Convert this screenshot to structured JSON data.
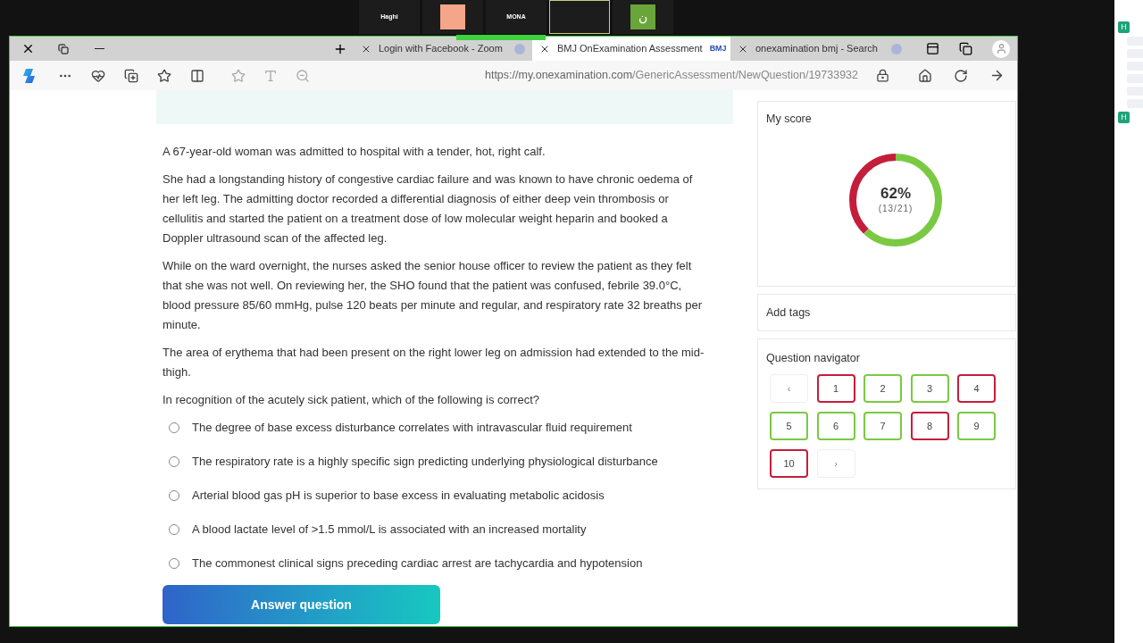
{
  "meeting": {
    "participants": [
      {
        "name": "Haghi",
        "kind": "name"
      },
      {
        "kind": "color",
        "color": "#f4a58a"
      },
      {
        "name": "MONA",
        "kind": "name"
      },
      {
        "kind": "blank",
        "selected": true
      },
      {
        "name": "ن",
        "kind": "avatar",
        "color": "#6aa53a"
      }
    ]
  },
  "browser": {
    "tabs": [
      {
        "title": "Login with Facebook - Zoom",
        "selected": false
      },
      {
        "title": "BMJ OnExamination Assessment",
        "badge": "BMJ",
        "selected": true
      },
      {
        "title": "onexamination bmj - Search",
        "selected": false
      }
    ],
    "url_host": "https://my.onexamination.com",
    "url_path": "/GenericAssessment/NewQuestion/19733932"
  },
  "question": {
    "paragraphs": [
      "A 67-year-old woman was admitted to hospital with a tender, hot, right calf.",
      "She had a longstanding history of congestive cardiac failure and was known to have chronic oedema of her left leg. The admitting doctor recorded a differential diagnosis of either deep vein thrombosis or cellulitis and started the patient on a treatment dose of low molecular weight heparin and booked a Doppler ultrasound scan of the affected leg.",
      "While on the ward overnight, the nurses asked the senior house officer to review the patient as they felt that she was not well. On reviewing her, the SHO found that the patient was confused, febrile 39.0°C, blood pressure 85/60 mmHg, pulse 120 beats per minute and regular, and respiratory rate 32 breaths per minute.",
      "The area of erythema that had been present on the right lower leg on admission had extended to the mid-thigh.",
      "In recognition of the acutely sick patient, which of the following is correct?"
    ],
    "options": [
      {
        "text": "The degree of base excess disturbance correlates with intravascular fluid requirement",
        "selected": false
      },
      {
        "text": "The respiratory rate is a highly specific sign predicting underlying physiological disturbance",
        "selected": false
      },
      {
        "text": "Arterial blood gas pH is superior to base excess in evaluating metabolic acidosis",
        "selected": false
      },
      {
        "text": "A blood lactate level of >1.5 mmol/L is associated with an increased mortality",
        "selected": false
      },
      {
        "text": "The commonest clinical signs preceding cardiac arrest are tachycardia and hypotension",
        "selected": false
      }
    ],
    "submit": "Answer question"
  },
  "score": {
    "title": "My score",
    "percent": "62%",
    "fraction": "(13/21)",
    "level": 0.62
  },
  "tags": {
    "title": "Add tags"
  },
  "navigator": {
    "title": "Question navigator",
    "prev": "‹",
    "next": "›",
    "items": [
      {
        "label": "1",
        "color": "#c41e3a"
      },
      {
        "label": "2",
        "color": "#7ac943"
      },
      {
        "label": "3",
        "color": "#7ac943"
      },
      {
        "label": "4",
        "color": "#c41e3a"
      },
      {
        "label": "5",
        "color": "#7ac943"
      },
      {
        "label": "6",
        "color": "#7ac943"
      },
      {
        "label": "7",
        "color": "#7ac943"
      },
      {
        "label": "8",
        "color": "#c41e3a"
      },
      {
        "label": "9",
        "color": "#7ac943"
      },
      {
        "label": "10",
        "color": "#c41e3a"
      }
    ]
  },
  "chat": {
    "avatars": [
      "H",
      "H"
    ]
  }
}
